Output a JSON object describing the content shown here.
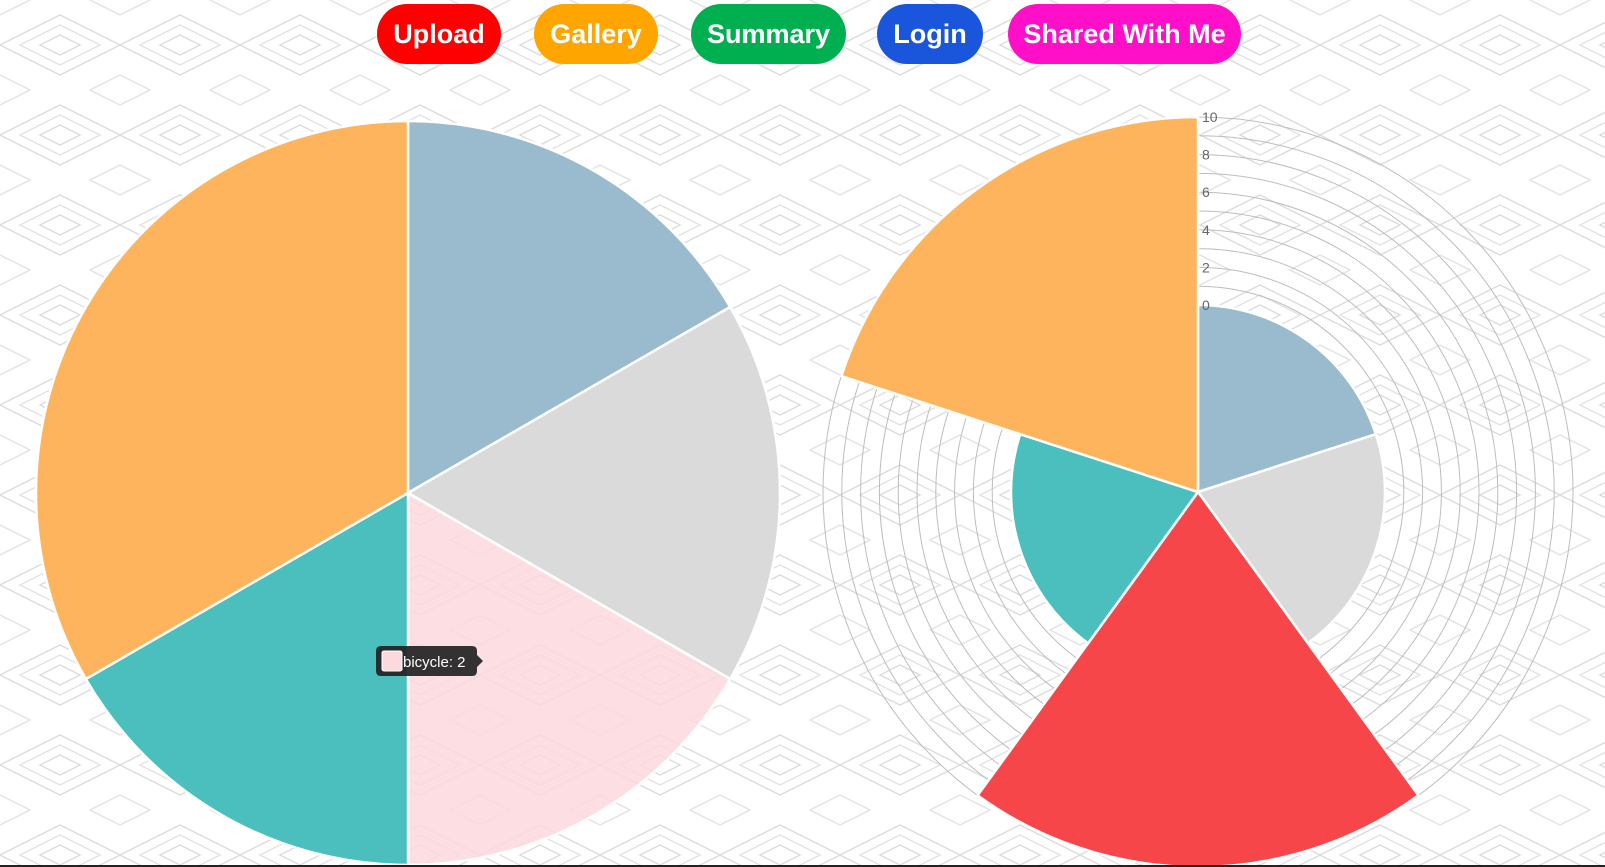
{
  "nav": {
    "buttons": [
      {
        "label": "Upload",
        "color": "#ff0000"
      },
      {
        "label": "Gallery",
        "color": "#ffa500"
      },
      {
        "label": "Summary",
        "color": "#00b050"
      },
      {
        "label": "Login",
        "color": "#1a56db"
      },
      {
        "label": "Shared With Me",
        "color": "#ff10c8"
      }
    ]
  },
  "chart_data": [
    {
      "type": "pie",
      "categories": [
        "",
        "",
        "bicycle",
        "",
        ""
      ],
      "values": [
        2,
        2,
        2,
        2,
        4
      ],
      "colors": [
        "#9abbce",
        "#dadada",
        "#fdd9de",
        "#4abfbd",
        "#fdb45d"
      ],
      "title": "",
      "tooltip": {
        "text": "bicycle: 2",
        "swatch_color": "#fdd9de"
      },
      "legend": "none"
    },
    {
      "type": "polar-area",
      "categories": [
        "",
        "",
        "",
        "",
        ""
      ],
      "values": [
        2,
        2,
        10,
        2,
        10
      ],
      "colors": [
        "#9abbce",
        "#dadada",
        "#f7464a",
        "#4abfbd",
        "#fdb45d"
      ],
      "r_ticks": [
        0,
        2,
        4,
        6,
        8,
        10
      ],
      "r_range": [
        0,
        10
      ],
      "title": "",
      "legend": "none"
    }
  ]
}
